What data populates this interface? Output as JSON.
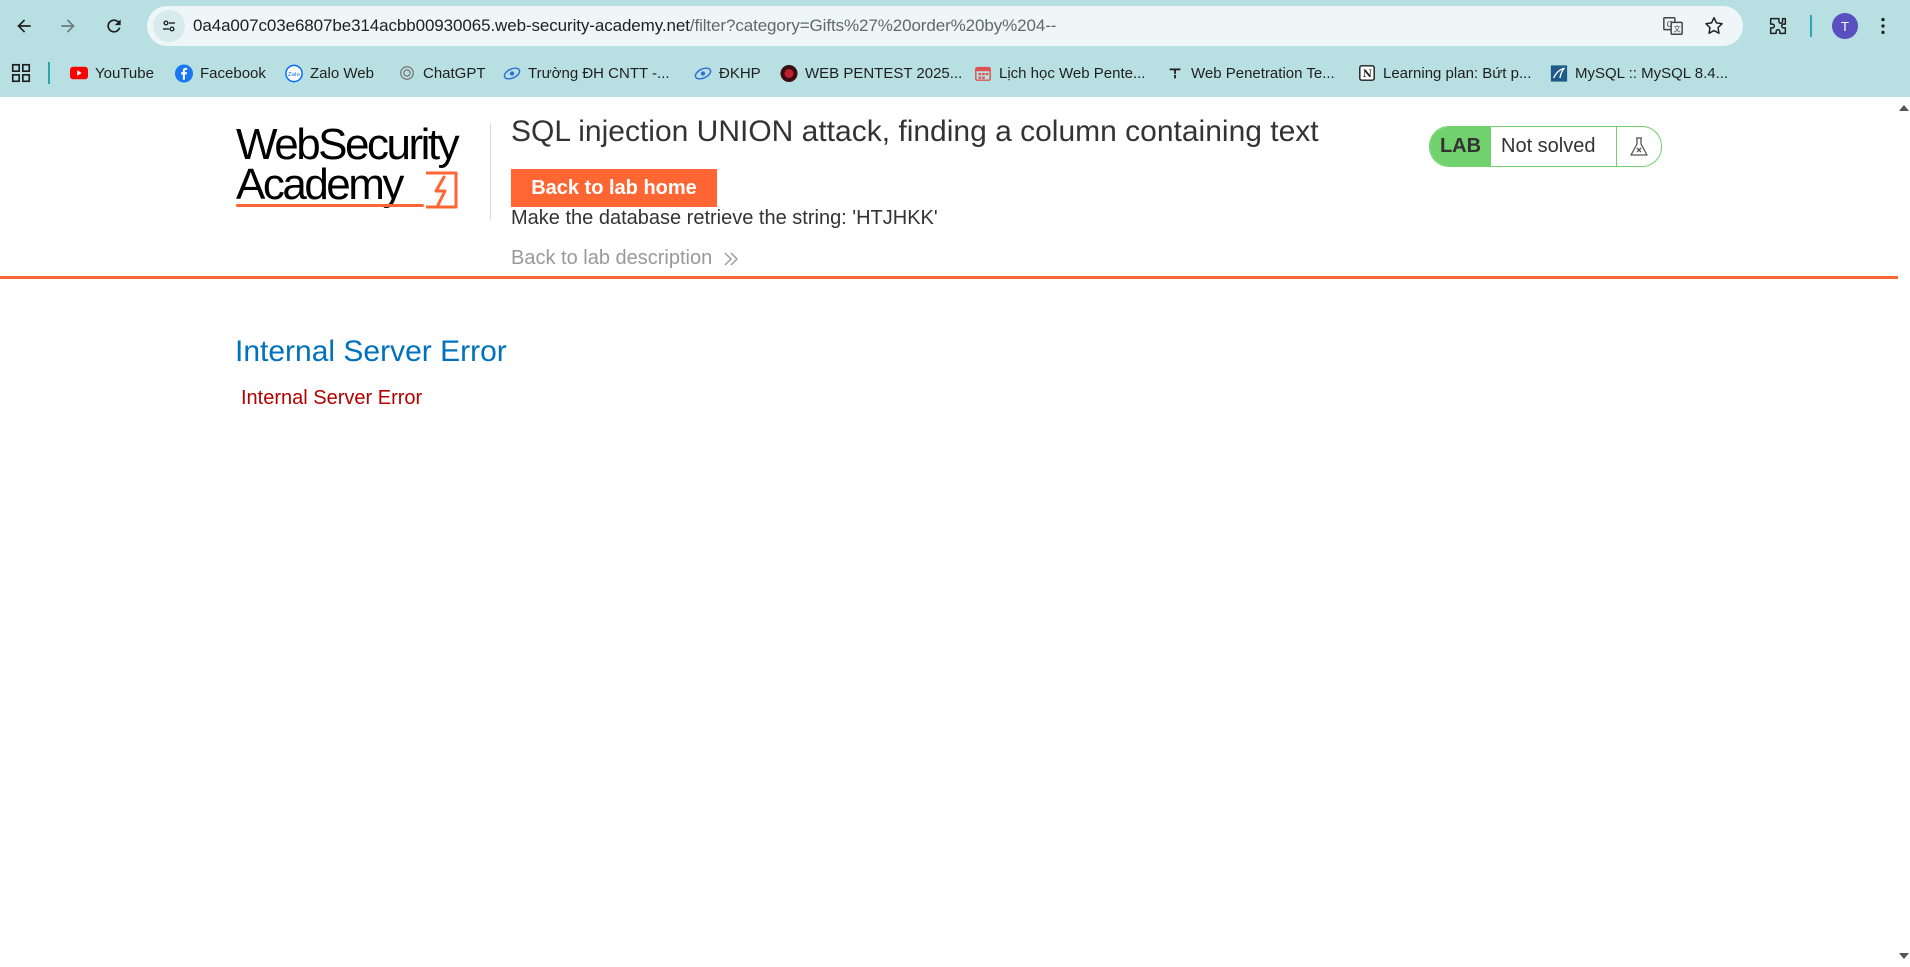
{
  "browser": {
    "url_host": "0a4a007c03e6807be314acbb00930065.web-security-academy.net",
    "url_path": "/filter?category=Gifts%27%20order%20by%204--",
    "profile_initial": "T",
    "bookmarks": [
      {
        "label": "YouTube",
        "icon": "youtube-icon"
      },
      {
        "label": "Facebook",
        "icon": "facebook-icon"
      },
      {
        "label": "Zalo Web",
        "icon": "zalo-icon"
      },
      {
        "label": "ChatGPT",
        "icon": "chatgpt-icon"
      },
      {
        "label": "Trường ĐH CNTT -...",
        "icon": "uit-icon"
      },
      {
        "label": "ĐKHP",
        "icon": "uit-icon"
      },
      {
        "label": "WEB PENTEST 2025...",
        "icon": "pentest-icon"
      },
      {
        "label": "Lịch học Web Pente...",
        "icon": "calendar-icon"
      },
      {
        "label": "Web Penetration Te...",
        "icon": "portswigger-icon"
      },
      {
        "label": "Learning plan: Bứt p...",
        "icon": "notion-icon"
      },
      {
        "label": "MySQL :: MySQL 8.4...",
        "icon": "mysql-icon"
      }
    ]
  },
  "header": {
    "logo_line1": "WebSecurity",
    "logo_line2": "Academy",
    "lab_title": "SQL injection UNION attack, finding a column containing text",
    "back_home_label": "Back to lab home",
    "objective": "Make the database retrieve the string: 'HTJHKK'",
    "back_description_label": "Back to lab description",
    "status_badge": "LAB",
    "status_text": "Not solved"
  },
  "main": {
    "error_heading": "Internal Server Error",
    "error_message": "Internal Server Error"
  },
  "colors": {
    "accent": "#ff6633",
    "lab_green": "#70d16d",
    "error_heading": "#0071bc",
    "error_text": "#b30000",
    "chrome_bg": "#b8e0e2"
  }
}
